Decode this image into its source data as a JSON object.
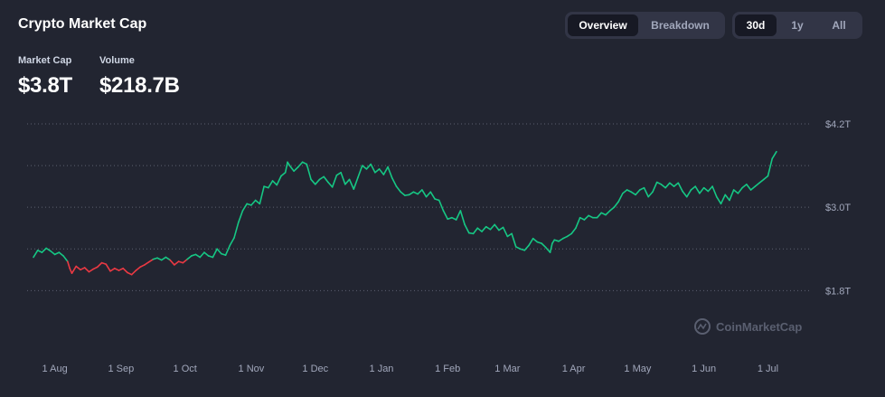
{
  "header": {
    "title": "Crypto Market Cap",
    "view_tabs": [
      {
        "label": "Overview",
        "active": true
      },
      {
        "label": "Breakdown",
        "active": false
      }
    ],
    "range_tabs": [
      {
        "label": "30d",
        "active": true
      },
      {
        "label": "1y",
        "active": false
      },
      {
        "label": "All",
        "active": false
      }
    ]
  },
  "stats": {
    "market_cap": {
      "label": "Market Cap",
      "value": "$3.8T"
    },
    "volume": {
      "label": "Volume",
      "value": "$218.7B"
    }
  },
  "watermark": {
    "text": "CoinMarketCap",
    "icon": "coinmarketcap-logo-icon"
  },
  "colors": {
    "background": "#222531",
    "up": "#16c784",
    "down": "#ea3943",
    "grid": "#5c6070",
    "tab_bg": "#323546",
    "tab_active_bg": "#171924",
    "text_muted": "#a1a7bb"
  },
  "chart_data": {
    "type": "line",
    "y_unit": "USD trillions",
    "ylim": [
      1.44,
      4.2
    ],
    "y_ticks": [
      {
        "value": 4.2,
        "label": "$4.2T"
      },
      {
        "value": 3.0,
        "label": "$3.0T"
      },
      {
        "value": 1.8,
        "label": "$1.8T"
      }
    ],
    "y_gridlines": [
      4.2,
      3.6,
      3.0,
      2.4,
      1.8
    ],
    "x_ticks": [
      {
        "label": "1 Aug",
        "day": 10
      },
      {
        "label": "1 Sep",
        "day": 41
      },
      {
        "label": "1 Oct",
        "day": 71
      },
      {
        "label": "1 Nov",
        "day": 102
      },
      {
        "label": "1 Dec",
        "day": 132
      },
      {
        "label": "1 Jan",
        "day": 163
      },
      {
        "label": "1 Feb",
        "day": 194
      },
      {
        "label": "1 Mar",
        "day": 222
      },
      {
        "label": "1 Apr",
        "day": 253
      },
      {
        "label": "1 May",
        "day": 283
      },
      {
        "label": "1 Jun",
        "day": 314
      },
      {
        "label": "1 Jul",
        "day": 344
      },
      {
        "label": "",
        "day": 362
      }
    ],
    "baseline": 2.25,
    "points": [
      [
        0,
        2.28
      ],
      [
        2,
        2.38
      ],
      [
        4,
        2.35
      ],
      [
        6,
        2.41
      ],
      [
        8,
        2.37
      ],
      [
        10,
        2.32
      ],
      [
        12,
        2.35
      ],
      [
        14,
        2.3
      ],
      [
        16,
        2.22
      ],
      [
        17,
        2.12
      ],
      [
        18,
        2.05
      ],
      [
        20,
        2.15
      ],
      [
        22,
        2.1
      ],
      [
        24,
        2.13
      ],
      [
        26,
        2.07
      ],
      [
        28,
        2.11
      ],
      [
        30,
        2.14
      ],
      [
        32,
        2.2
      ],
      [
        34,
        2.18
      ],
      [
        36,
        2.08
      ],
      [
        38,
        2.12
      ],
      [
        40,
        2.09
      ],
      [
        42,
        2.12
      ],
      [
        44,
        2.06
      ],
      [
        46,
        2.03
      ],
      [
        48,
        2.09
      ],
      [
        50,
        2.14
      ],
      [
        52,
        2.17
      ],
      [
        54,
        2.21
      ],
      [
        56,
        2.25
      ],
      [
        58,
        2.27
      ],
      [
        60,
        2.24
      ],
      [
        62,
        2.28
      ],
      [
        64,
        2.24
      ],
      [
        66,
        2.17
      ],
      [
        68,
        2.22
      ],
      [
        70,
        2.2
      ],
      [
        72,
        2.25
      ],
      [
        74,
        2.3
      ],
      [
        76,
        2.32
      ],
      [
        78,
        2.28
      ],
      [
        80,
        2.35
      ],
      [
        82,
        2.3
      ],
      [
        84,
        2.28
      ],
      [
        86,
        2.4
      ],
      [
        88,
        2.33
      ],
      [
        90,
        2.31
      ],
      [
        92,
        2.45
      ],
      [
        94,
        2.56
      ],
      [
        96,
        2.78
      ],
      [
        98,
        2.95
      ],
      [
        100,
        3.05
      ],
      [
        102,
        3.03
      ],
      [
        104,
        3.1
      ],
      [
        106,
        3.05
      ],
      [
        108,
        3.3
      ],
      [
        110,
        3.28
      ],
      [
        112,
        3.38
      ],
      [
        114,
        3.32
      ],
      [
        116,
        3.45
      ],
      [
        118,
        3.5
      ],
      [
        119,
        3.65
      ],
      [
        120,
        3.6
      ],
      [
        122,
        3.52
      ],
      [
        124,
        3.58
      ],
      [
        126,
        3.65
      ],
      [
        128,
        3.62
      ],
      [
        130,
        3.4
      ],
      [
        132,
        3.33
      ],
      [
        134,
        3.4
      ],
      [
        136,
        3.44
      ],
      [
        138,
        3.36
      ],
      [
        140,
        3.29
      ],
      [
        142,
        3.46
      ],
      [
        144,
        3.5
      ],
      [
        146,
        3.33
      ],
      [
        148,
        3.4
      ],
      [
        150,
        3.26
      ],
      [
        152,
        3.43
      ],
      [
        154,
        3.6
      ],
      [
        156,
        3.55
      ],
      [
        158,
        3.62
      ],
      [
        160,
        3.5
      ],
      [
        162,
        3.55
      ],
      [
        164,
        3.47
      ],
      [
        166,
        3.58
      ],
      [
        168,
        3.42
      ],
      [
        170,
        3.3
      ],
      [
        172,
        3.22
      ],
      [
        174,
        3.17
      ],
      [
        176,
        3.18
      ],
      [
        178,
        3.22
      ],
      [
        180,
        3.19
      ],
      [
        182,
        3.25
      ],
      [
        184,
        3.15
      ],
      [
        186,
        3.22
      ],
      [
        188,
        3.12
      ],
      [
        190,
        3.1
      ],
      [
        192,
        2.95
      ],
      [
        194,
        2.83
      ],
      [
        196,
        2.85
      ],
      [
        198,
        2.82
      ],
      [
        200,
        2.95
      ],
      [
        202,
        2.75
      ],
      [
        204,
        2.63
      ],
      [
        206,
        2.62
      ],
      [
        208,
        2.7
      ],
      [
        210,
        2.65
      ],
      [
        212,
        2.72
      ],
      [
        214,
        2.68
      ],
      [
        216,
        2.75
      ],
      [
        218,
        2.67
      ],
      [
        220,
        2.71
      ],
      [
        222,
        2.58
      ],
      [
        224,
        2.62
      ],
      [
        226,
        2.43
      ],
      [
        228,
        2.4
      ],
      [
        230,
        2.38
      ],
      [
        232,
        2.45
      ],
      [
        234,
        2.55
      ],
      [
        236,
        2.5
      ],
      [
        238,
        2.48
      ],
      [
        240,
        2.42
      ],
      [
        242,
        2.35
      ],
      [
        243,
        2.48
      ],
      [
        244,
        2.53
      ],
      [
        246,
        2.51
      ],
      [
        248,
        2.55
      ],
      [
        250,
        2.58
      ],
      [
        252,
        2.62
      ],
      [
        254,
        2.7
      ],
      [
        256,
        2.85
      ],
      [
        258,
        2.82
      ],
      [
        260,
        2.88
      ],
      [
        262,
        2.85
      ],
      [
        264,
        2.85
      ],
      [
        266,
        2.92
      ],
      [
        268,
        2.89
      ],
      [
        270,
        2.95
      ],
      [
        272,
        3.0
      ],
      [
        274,
        3.08
      ],
      [
        276,
        3.2
      ],
      [
        278,
        3.25
      ],
      [
        280,
        3.22
      ],
      [
        282,
        3.18
      ],
      [
        284,
        3.25
      ],
      [
        286,
        3.28
      ],
      [
        288,
        3.15
      ],
      [
        290,
        3.22
      ],
      [
        292,
        3.36
      ],
      [
        294,
        3.33
      ],
      [
        296,
        3.28
      ],
      [
        298,
        3.35
      ],
      [
        300,
        3.3
      ],
      [
        302,
        3.35
      ],
      [
        304,
        3.23
      ],
      [
        306,
        3.15
      ],
      [
        308,
        3.25
      ],
      [
        310,
        3.3
      ],
      [
        312,
        3.2
      ],
      [
        314,
        3.28
      ],
      [
        316,
        3.23
      ],
      [
        318,
        3.3
      ],
      [
        320,
        3.15
      ],
      [
        322,
        3.05
      ],
      [
        324,
        3.18
      ],
      [
        326,
        3.1
      ],
      [
        328,
        3.25
      ],
      [
        330,
        3.2
      ],
      [
        332,
        3.28
      ],
      [
        334,
        3.33
      ],
      [
        336,
        3.25
      ],
      [
        338,
        3.3
      ],
      [
        340,
        3.35
      ],
      [
        342,
        3.4
      ],
      [
        344,
        3.45
      ],
      [
        346,
        3.7
      ],
      [
        348,
        3.8
      ]
    ]
  }
}
